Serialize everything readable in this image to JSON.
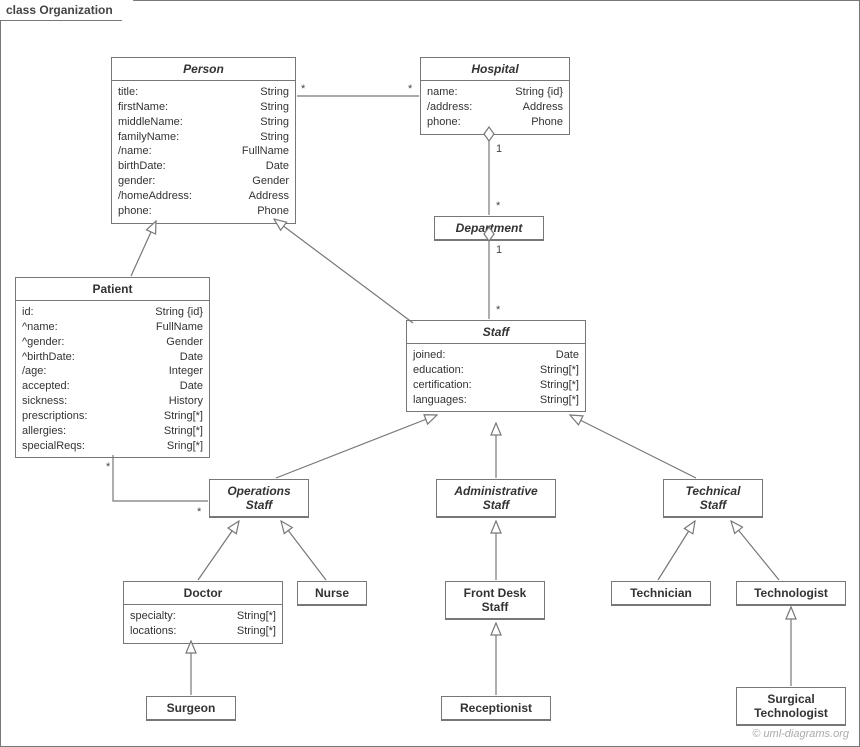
{
  "frame": {
    "title": "class Organization"
  },
  "classes": {
    "person": {
      "name": "Person",
      "attrs": [
        {
          "n": "title:",
          "t": "String"
        },
        {
          "n": "firstName:",
          "t": "String"
        },
        {
          "n": "middleName:",
          "t": "String"
        },
        {
          "n": "familyName:",
          "t": "String"
        },
        {
          "n": "/name:",
          "t": "FullName"
        },
        {
          "n": "birthDate:",
          "t": "Date"
        },
        {
          "n": "gender:",
          "t": "Gender"
        },
        {
          "n": "/homeAddress:",
          "t": "Address"
        },
        {
          "n": "phone:",
          "t": "Phone"
        }
      ]
    },
    "hospital": {
      "name": "Hospital",
      "attrs": [
        {
          "n": "name:",
          "t": "String {id}"
        },
        {
          "n": "/address:",
          "t": "Address"
        },
        {
          "n": "phone:",
          "t": "Phone"
        }
      ]
    },
    "department": {
      "name": "Department"
    },
    "patient": {
      "name": "Patient",
      "attrs": [
        {
          "n": "id:",
          "t": "String {id}"
        },
        {
          "n": "^name:",
          "t": "FullName"
        },
        {
          "n": "^gender:",
          "t": "Gender"
        },
        {
          "n": "^birthDate:",
          "t": "Date"
        },
        {
          "n": "/age:",
          "t": "Integer"
        },
        {
          "n": "accepted:",
          "t": "Date"
        },
        {
          "n": "sickness:",
          "t": "History"
        },
        {
          "n": "prescriptions:",
          "t": "String[*]"
        },
        {
          "n": "allergies:",
          "t": "String[*]"
        },
        {
          "n": "specialReqs:",
          "t": "Sring[*]"
        }
      ]
    },
    "staff": {
      "name": "Staff",
      "attrs": [
        {
          "n": "joined:",
          "t": "Date"
        },
        {
          "n": "education:",
          "t": "String[*]"
        },
        {
          "n": "certification:",
          "t": "String[*]"
        },
        {
          "n": "languages:",
          "t": "String[*]"
        }
      ]
    },
    "opsStaff": {
      "name1": "Operations",
      "name2": "Staff"
    },
    "adminStaff": {
      "name1": "Administrative",
      "name2": "Staff"
    },
    "techStaff": {
      "name1": "Technical",
      "name2": "Staff"
    },
    "doctor": {
      "name": "Doctor",
      "attrs": [
        {
          "n": "specialty:",
          "t": "String[*]"
        },
        {
          "n": "locations:",
          "t": "String[*]"
        }
      ]
    },
    "nurse": {
      "name": "Nurse"
    },
    "frontDesk": {
      "name1": "Front Desk",
      "name2": "Staff"
    },
    "technician": {
      "name": "Technician"
    },
    "technologist": {
      "name": "Technologist"
    },
    "surgeon": {
      "name": "Surgeon"
    },
    "receptionist": {
      "name": "Receptionist"
    },
    "surgTech": {
      "name1": "Surgical",
      "name2": "Technologist"
    }
  },
  "mult": {
    "personHospital_l": "*",
    "personHospital_r": "*",
    "hospDept_top": "1",
    "hospDept_bot": "*",
    "deptStaff_top": "1",
    "deptStaff_bot": "*",
    "patientOps_l": "*",
    "patientOps_r": "*"
  },
  "watermark": "© uml-diagrams.org"
}
